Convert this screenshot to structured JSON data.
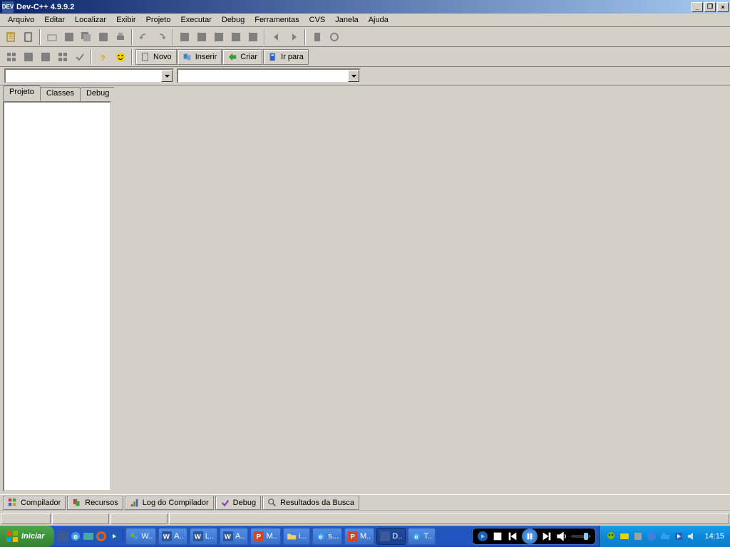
{
  "titlebar": {
    "title": "Dev-C++ 4.9.9.2"
  },
  "menubar": [
    "Arquivo",
    "Editar",
    "Localizar",
    "Exibir",
    "Projeto",
    "Executar",
    "Debug",
    "Ferramentas",
    "CVS",
    "Janela",
    "Ajuda"
  ],
  "toolbar2": {
    "novo": "Novo",
    "inserir": "Inserir",
    "criar": "Criar",
    "irpara": "Ir para"
  },
  "sidetabs": [
    "Projeto",
    "Classes",
    "Debug"
  ],
  "bottomtabs": [
    "Compilador",
    "Recursos",
    "Log do Compilador",
    "Debug",
    "Resultados da Busca"
  ],
  "taskbar": {
    "start": "Iniciar",
    "tasks": [
      "W..",
      "A..",
      "L..",
      "A..",
      "M..",
      "i...",
      "s...",
      "M..",
      "D..",
      "T.."
    ],
    "clock": "14:15"
  }
}
